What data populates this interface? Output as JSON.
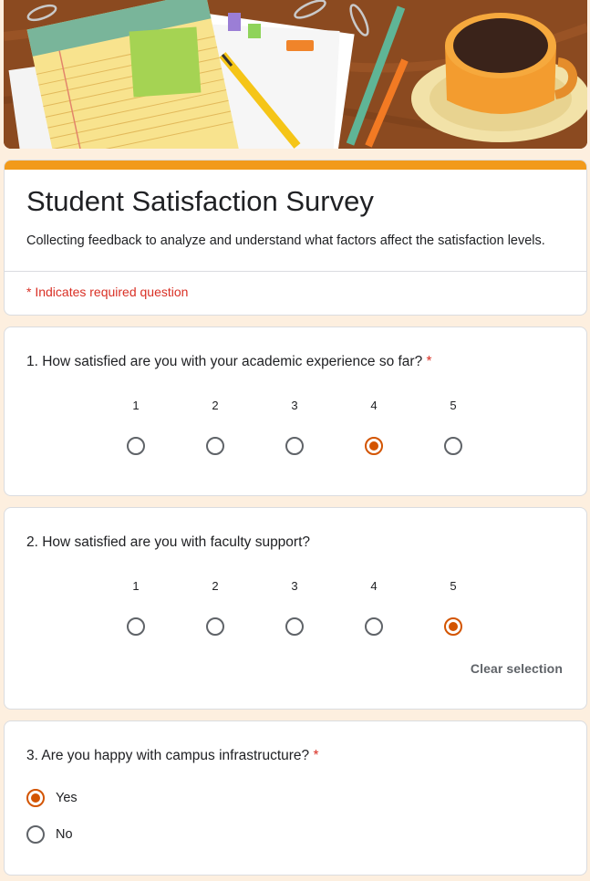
{
  "form": {
    "title": "Student Satisfaction Survey",
    "description": "Collecting feedback to analyze and understand what factors affect the satisfaction levels.",
    "required_note": "* Indicates required question",
    "accent_color": "#f29a1a",
    "selected_color": "#d35400"
  },
  "questions": [
    {
      "title": "1. How satisfied are you with your academic experience so far?",
      "required": true,
      "asterisk": "*",
      "scale": [
        "1",
        "2",
        "3",
        "4",
        "5"
      ],
      "selected": "4"
    },
    {
      "title": "2. How satisfied are you with faculty support?",
      "required": false,
      "scale": [
        "1",
        "2",
        "3",
        "4",
        "5"
      ],
      "selected": "5",
      "clear_label": "Clear selection"
    },
    {
      "title": "3. Are you happy with campus infrastructure?",
      "required": true,
      "asterisk": "*",
      "options": [
        "Yes",
        "No"
      ],
      "selected": "Yes"
    }
  ]
}
